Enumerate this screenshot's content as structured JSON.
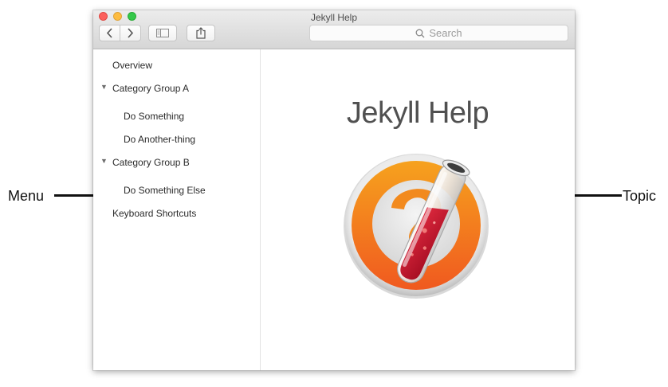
{
  "annotations": {
    "menu_label": "Menu",
    "topic_label": "Topic"
  },
  "window": {
    "title": "Jekyll Help"
  },
  "toolbar": {
    "back_icon": "chevron-left-icon",
    "forward_icon": "chevron-right-icon",
    "sidebar_icon": "sidebar-icon",
    "share_icon": "share-icon"
  },
  "search": {
    "placeholder": "Search"
  },
  "sidebar": {
    "items": [
      {
        "label": "Overview"
      },
      {
        "label": "Category Group A"
      },
      {
        "label": "Do Something"
      },
      {
        "label": "Do Another-thing"
      },
      {
        "label": "Category Group B"
      },
      {
        "label": "Do Something Else"
      },
      {
        "label": "Keyboard Shortcuts"
      }
    ]
  },
  "topic": {
    "title": "Jekyll Help",
    "icon": "jekyll-flask-icon"
  },
  "colors": {
    "close": "#fc605c",
    "minimize": "#fdbc40",
    "maximize": "#34c84a",
    "icon_orange": "#f58a1f",
    "icon_red": "#c8102e"
  }
}
